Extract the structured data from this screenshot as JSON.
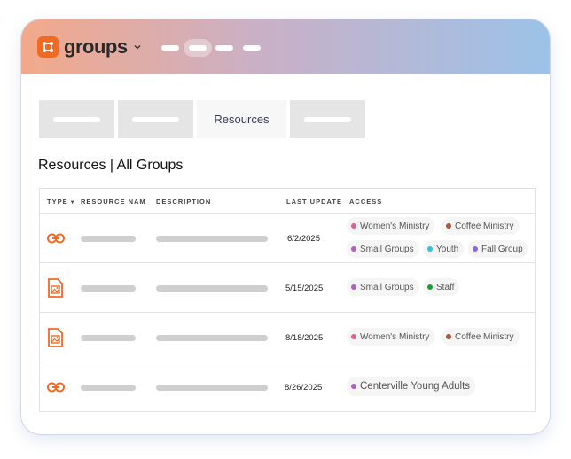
{
  "app": {
    "name": "groups"
  },
  "tabs": [
    {
      "label": ""
    },
    {
      "label": ""
    },
    {
      "label": "Resources",
      "active": true
    },
    {
      "label": ""
    }
  ],
  "page_title": "Resources | All Groups",
  "table": {
    "headers": {
      "type": "TYPE",
      "name": "RESOURCE NAME",
      "description": "DESCRIPTION",
      "last_update": "LAST UPDATE",
      "access": "ACCESS"
    },
    "rows": [
      {
        "type_icon": "link-icon",
        "last_update": "6/2/2025",
        "access": [
          "Women's Ministry",
          "Coffee Ministry",
          "Small Groups",
          "Youth",
          "Fall Group"
        ]
      },
      {
        "type_icon": "image-file-icon",
        "last_update": "5/15/2025",
        "access": [
          "Small Groups",
          "Staff"
        ]
      },
      {
        "type_icon": "image-file-icon",
        "last_update": "8/18/2025",
        "access": [
          "Women's Ministry",
          "Coffee Ministry"
        ]
      },
      {
        "type_icon": "link-icon",
        "last_update": "8/26/2025",
        "access": [
          "Centerville Young Adults"
        ]
      }
    ]
  },
  "colors": {
    "brand": "#f26a21",
    "womens_ministry": "#e0608a",
    "coffee_ministry": "#b0583c",
    "small_groups": "#b05fc4",
    "youth": "#38c0d8",
    "fall_group": "#8a6ae0",
    "staff": "#1f9d3a",
    "centerville_young_adults": "#b05fc4"
  }
}
